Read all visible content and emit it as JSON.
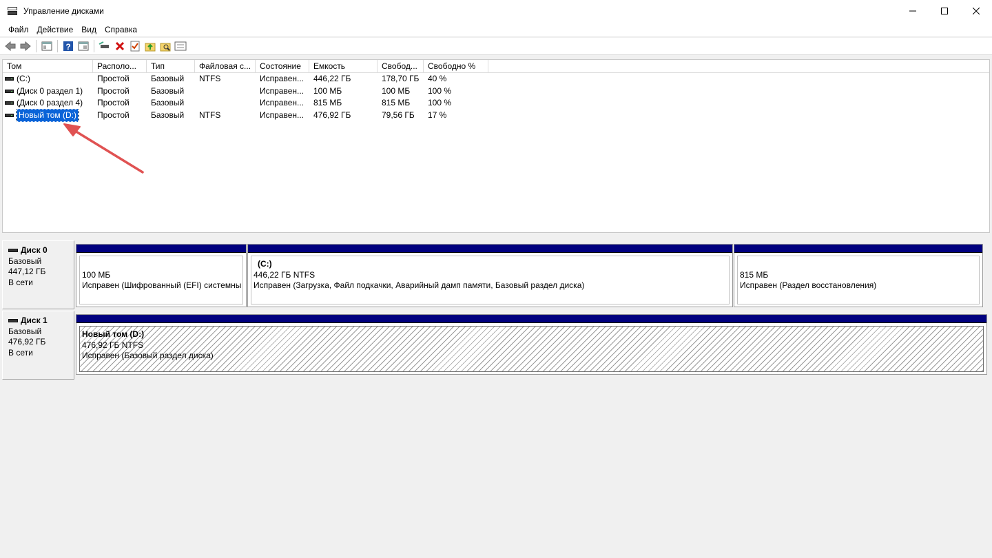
{
  "window": {
    "title": "Управление дисками"
  },
  "menu": [
    "Файл",
    "Действие",
    "Вид",
    "Справка"
  ],
  "toolbar": {
    "icons": [
      "back-icon",
      "forward-icon",
      "console-tree-icon",
      "help-icon",
      "properties-icon",
      "connect-icon",
      "delete-icon",
      "checklist-icon",
      "folder-up-icon",
      "folder-search-icon",
      "list-icon"
    ]
  },
  "table": {
    "headers": [
      "Том",
      "Располо...",
      "Тип",
      "Файловая с...",
      "Состояние",
      "Емкость",
      "Свобод...",
      "Свободно %"
    ],
    "rows": [
      [
        "(C:)",
        "Простой",
        "Базовый",
        "NTFS",
        "Исправен...",
        "446,22 ГБ",
        "178,70 ГБ",
        "40 %"
      ],
      [
        "(Диск 0 раздел 1)",
        "Простой",
        "Базовый",
        "",
        "Исправен...",
        "100 МБ",
        "100 МБ",
        "100 %"
      ],
      [
        "(Диск 0 раздел 4)",
        "Простой",
        "Базовый",
        "",
        "Исправен...",
        "815 МБ",
        "815 МБ",
        "100 %"
      ],
      [
        "Новый том (D:)",
        "Простой",
        "Базовый",
        "NTFS",
        "Исправен...",
        "476,92 ГБ",
        "79,56 ГБ",
        "17 %"
      ]
    ],
    "selected_row": 3
  },
  "disks": [
    {
      "name": "Диск 0",
      "type": "Базовый",
      "size": "447,12 ГБ",
      "status": "В сети",
      "partitions": [
        {
          "title": "",
          "size": "100 МБ",
          "status": "Исправен (Шифрованный (EFI) системны"
        },
        {
          "title": "(C:)",
          "size": "446,22 ГБ NTFS",
          "status": "Исправен (Загрузка, Файл подкачки, Аварийный дамп памяти, Базовый раздел диска)"
        },
        {
          "title": "",
          "size": "815 МБ",
          "status": "Исправен (Раздел восстановления)"
        }
      ]
    },
    {
      "name": "Диск 1",
      "type": "Базовый",
      "size": "476,92 ГБ",
      "status": "В сети",
      "partitions": [
        {
          "title": "Новый том  (D:)",
          "size": "476,92 ГБ NTFS",
          "status": "Исправен (Базовый раздел диска)"
        }
      ]
    }
  ],
  "colors": {
    "partition_bar": "#00007f",
    "selection": "#0a64d8",
    "annotation_arrow": "#e05252"
  }
}
